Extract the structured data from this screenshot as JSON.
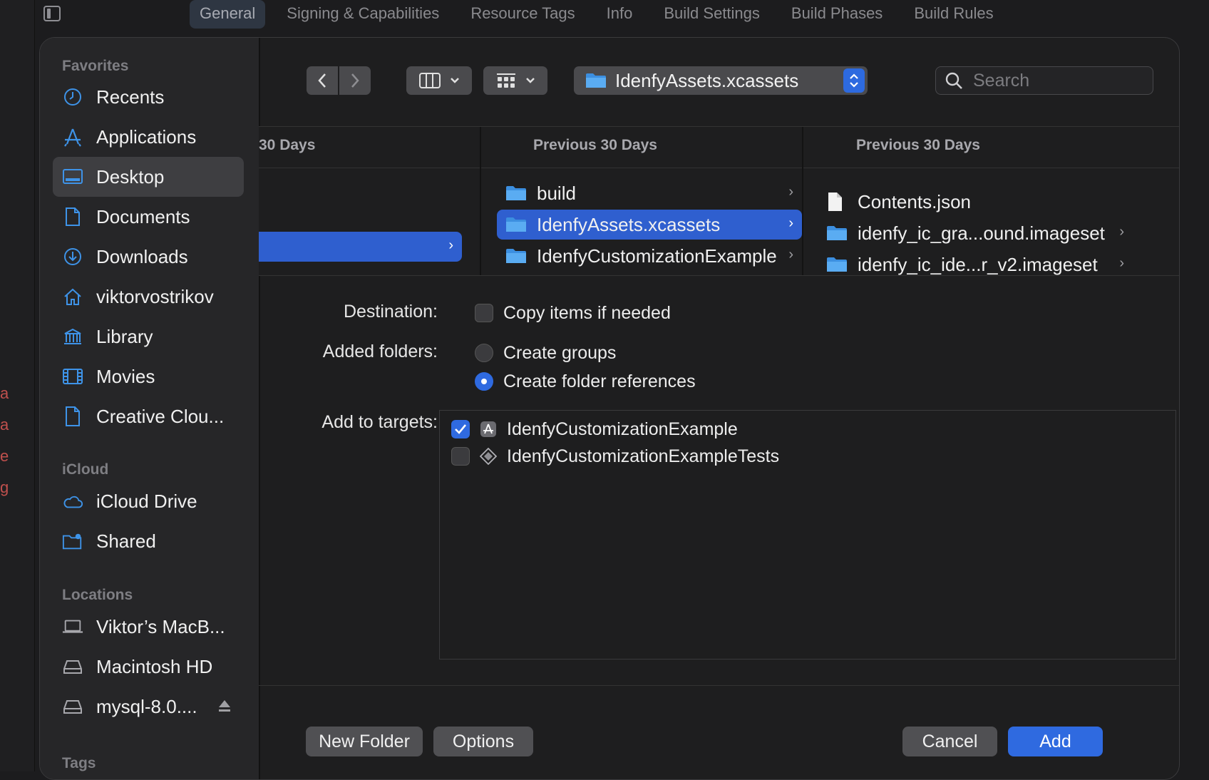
{
  "xcode": {
    "tabs": [
      "General",
      "Signing & Capabilities",
      "Resource Tags",
      "Info",
      "Build Settings",
      "Build Phases",
      "Build Rules"
    ],
    "active_tab": "General",
    "left_marks": [
      "a",
      "a",
      "",
      "e",
      "g"
    ]
  },
  "sidebar": {
    "favorites_title": "Favorites",
    "favorites": [
      {
        "label": "Recents",
        "icon": "clock-icon"
      },
      {
        "label": "Applications",
        "icon": "applications-icon"
      },
      {
        "label": "Desktop",
        "icon": "desktop-icon",
        "selected": true
      },
      {
        "label": "Documents",
        "icon": "document-icon"
      },
      {
        "label": "Downloads",
        "icon": "download-icon"
      },
      {
        "label": "viktorvostrikov",
        "icon": "home-icon"
      },
      {
        "label": "Library",
        "icon": "library-icon"
      },
      {
        "label": "Movies",
        "icon": "film-icon"
      },
      {
        "label": "Creative Clou...",
        "icon": "file-icon"
      }
    ],
    "icloud_title": "iCloud",
    "icloud": [
      {
        "label": "iCloud Drive",
        "icon": "cloud-icon"
      },
      {
        "label": "Shared",
        "icon": "shared-folder-icon"
      }
    ],
    "locations_title": "Locations",
    "locations": [
      {
        "label": "Viktor’s MacB...",
        "icon": "laptop-icon"
      },
      {
        "label": "Macintosh HD",
        "icon": "disk-icon"
      },
      {
        "label": "mysql-8.0....",
        "icon": "disk-icon",
        "eject": true
      }
    ],
    "tags_title": "Tags"
  },
  "toolbar": {
    "path_label": "IdenfyAssets.xcassets",
    "search_placeholder": "Search"
  },
  "browser": {
    "col1_header": "30 Days",
    "col2_header": "Previous 30 Days",
    "col3_header": "Previous 30 Days",
    "col2_items": [
      {
        "label": "build",
        "selected": false
      },
      {
        "label": "IdenfyAssets.xcassets",
        "selected": true
      },
      {
        "label": "IdenfyCustomizationExample",
        "selected": false
      }
    ],
    "col3_items": [
      {
        "label": "Contents.json",
        "type": "file"
      },
      {
        "label": "idenfy_ic_gra...ound.imageset",
        "type": "folder"
      },
      {
        "label": "idenfy_ic_ide...r_v2.imageset",
        "type": "folder"
      }
    ]
  },
  "options": {
    "destination_label": "Destination:",
    "copy_items_label": "Copy items if needed",
    "copy_items_checked": false,
    "added_folders_label": "Added folders:",
    "create_groups_label": "Create groups",
    "create_folder_refs_label": "Create folder references",
    "selected_folder_option": "Create folder references",
    "add_to_targets_label": "Add to targets:",
    "targets": [
      {
        "label": "IdenfyCustomizationExample",
        "checked": true,
        "icon": "app-target-icon"
      },
      {
        "label": "IdenfyCustomizationExampleTests",
        "checked": false,
        "icon": "test-target-icon"
      }
    ]
  },
  "buttons": {
    "new_folder": "New Folder",
    "options": "Options",
    "cancel": "Cancel",
    "add": "Add"
  },
  "colors": {
    "accent": "#2f6ae0",
    "selection": "#2f5fcf",
    "sidebar_icon": "#3e93e8"
  }
}
